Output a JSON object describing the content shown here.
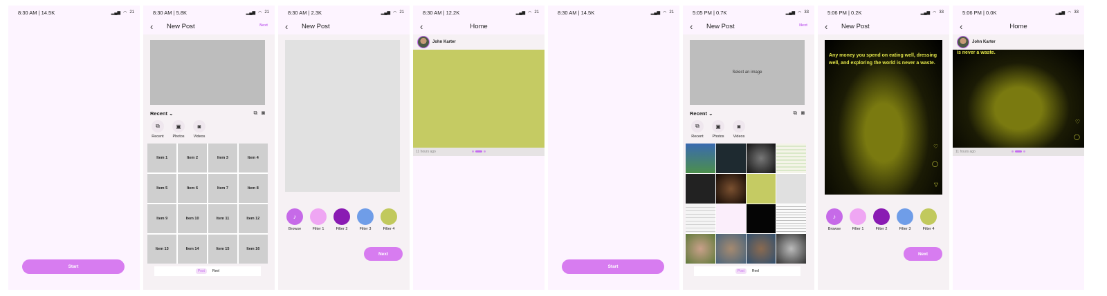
{
  "screens": [
    {
      "status": {
        "time": "8:30 AM | 14.5K",
        "battery": "21"
      },
      "start_label": "Start"
    },
    {
      "status": {
        "time": "8:30 AM | 5.8K",
        "battery": "21"
      },
      "title": "New Post",
      "next_label": "Next",
      "recent_label": "Recent",
      "media_tabs": [
        "Recent",
        "Photos",
        "Videos"
      ],
      "grid_items": [
        "Item 1",
        "Item 2",
        "Item 3",
        "Item 4",
        "Item 5",
        "Item 6",
        "Item 7",
        "Item 8",
        "Item 9",
        "Item 10",
        "Item 11",
        "Item 12",
        "Item 13",
        "Item 14",
        "Item 15",
        "Item 16"
      ],
      "toggle": [
        "Post",
        "Reel"
      ]
    },
    {
      "status": {
        "time": "8:30 AM | 2.3K",
        "battery": "21"
      },
      "title": "New Post",
      "filters": [
        "Browse",
        "Filter 1",
        "Filter 2",
        "Filter 3",
        "Filter 4"
      ],
      "next_button": "Next"
    },
    {
      "status": {
        "time": "8:30 AM | 12.2K",
        "battery": "21"
      },
      "title": "Home",
      "user": "John Karter",
      "time_ago": "11 hours ago"
    },
    {
      "status": {
        "time": "8:30 AM | 14.5K",
        "battery": "21"
      },
      "start_label": "Start"
    },
    {
      "status": {
        "time": "5:05 PM | 0.7K",
        "battery": "33"
      },
      "title": "New Post",
      "next_label": "Next",
      "select_image": "Select an image",
      "recent_label": "Recent",
      "media_tabs": [
        "Recent",
        "Photos",
        "Videos"
      ],
      "toggle": [
        "Post",
        "Reel"
      ]
    },
    {
      "status": {
        "time": "5:06 PM | 0.2K",
        "battery": "33"
      },
      "title": "New Post",
      "quote": "Any money you spend on eating well, dressing well, and exploring the world is never a waste.",
      "filters": [
        "Browse",
        "Filter 1",
        "Filter 2",
        "Filter 3",
        "Filter 4"
      ],
      "next_button": "Next"
    },
    {
      "status": {
        "time": "5:06 PM | 0.0K",
        "battery": "33"
      },
      "title": "Home",
      "user": "John Karter",
      "quote_tail": "is never a waste.",
      "time_ago": "11 hours ago"
    }
  ],
  "colors": {
    "accent": "#d77cf0",
    "filter_colors": [
      "#c66ae8",
      "#efa6f3",
      "#8a1bb3",
      "#6f9de8",
      "#c1c95d"
    ]
  }
}
